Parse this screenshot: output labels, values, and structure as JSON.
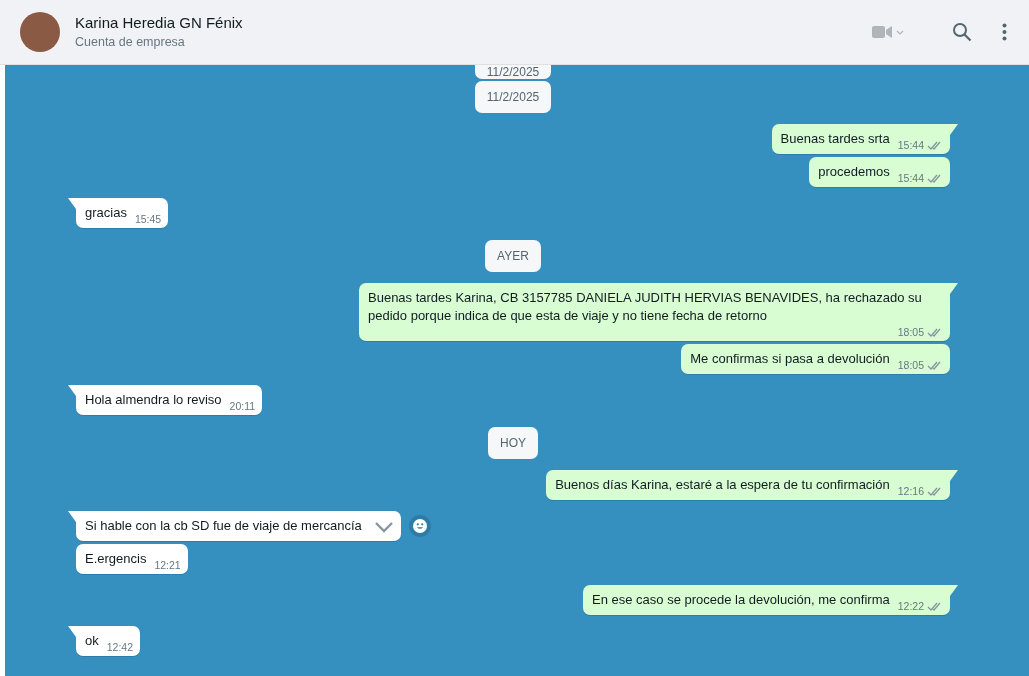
{
  "header": {
    "name": "Karina Heredia GN Fénix",
    "subtitle": "Cuenta de empresa"
  },
  "sticky_date": "11/2/2025",
  "messages": [
    {
      "kind": "date",
      "text": "11/2/2025"
    },
    {
      "kind": "outgoing",
      "text": "Buenas tardes srta",
      "time": "15:44",
      "first": true
    },
    {
      "kind": "outgoing",
      "text": "procedemos",
      "time": "15:44",
      "first": false
    },
    {
      "kind": "incoming",
      "text": "gracias",
      "time": "15:45",
      "first": true
    },
    {
      "kind": "date",
      "text": "AYER"
    },
    {
      "kind": "outgoing",
      "text": "Buenas tardes Karina, CB 3157785  DANIELA JUDITH HERVIAS BENAVIDES, ha rechazado su pedido porque indica de que esta de viaje y no tiene fecha de retorno",
      "time": "18:05",
      "first": true
    },
    {
      "kind": "outgoing",
      "text": "Me confirmas si pasa a devolución",
      "time": "18:05",
      "first": false
    },
    {
      "kind": "incoming",
      "text": "Hola almendra lo reviso",
      "time": "20:11",
      "first": true
    },
    {
      "kind": "date",
      "text": "HOY"
    },
    {
      "kind": "outgoing",
      "text": "Buenos días Karina, estaré a la espera de tu confirmación",
      "time": "12:16",
      "first": true
    },
    {
      "kind": "incoming",
      "text": "Si hable con la cb SD fue de viaje de mercancía",
      "hovered": true,
      "first": true
    },
    {
      "kind": "incoming",
      "text": "E.ergencis",
      "time": "12:21",
      "first": false
    },
    {
      "kind": "outgoing",
      "text": "En ese caso se procede la devolución, me confirma",
      "time": "12:22",
      "first": true
    },
    {
      "kind": "incoming",
      "text": "ok",
      "time": "12:42",
      "first": true
    }
  ]
}
